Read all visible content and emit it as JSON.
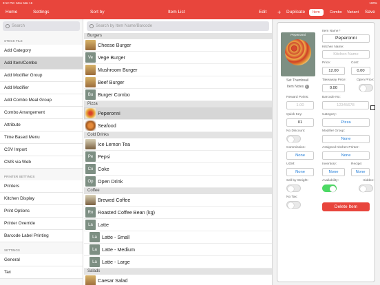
{
  "status": {
    "time": "9:12 PM",
    "date": "Mon Mar 16",
    "battery": "100%"
  },
  "topbar": {
    "home": "Home",
    "settings": "Settings",
    "sort_by": "Sort by",
    "item_list": "Item List",
    "edit": "Edit",
    "plus": "+",
    "duplicate": "Duplicate",
    "segments": [
      "Item",
      "Combo",
      "Variant"
    ],
    "active_segment": "Item",
    "save": "Save"
  },
  "sidebar": {
    "search_placeholder": "Search",
    "stock_file_header": "STOCK FILE",
    "stock_items": [
      "Add Category",
      "Add Item/Combo",
      "Add Modifier Group",
      "Add Modifier",
      "Add Combo Meal Group",
      "Combo Arrangement",
      "Attribute",
      "Time Based Menu",
      "CSV Import",
      "CMS via Web"
    ],
    "selected": "Add Item/Combo",
    "printer_header": "PRINTER SETTINGS",
    "printer_items": [
      "Printers",
      "Kitchen Display",
      "Print Options",
      "Printer Override",
      "Barcode Label Printing"
    ],
    "settings_header": "SETTINGS",
    "settings_items": [
      "General",
      "Tax"
    ]
  },
  "list": {
    "search_placeholder": "Search by Item Name/Barcode",
    "categories": [
      {
        "name": "Burgers",
        "items": [
          {
            "abbr": "",
            "name": "Cheese Burger",
            "thumb": "cb"
          },
          {
            "abbr": "Ve",
            "name": "Vege Burger"
          },
          {
            "abbr": "",
            "name": "Mushroom Burger",
            "thumb": "cb"
          },
          {
            "abbr": "",
            "name": "Beef Burger",
            "thumb": "cb"
          },
          {
            "abbr": "Bu",
            "name": "Burger Combo"
          }
        ]
      },
      {
        "name": "Pizza",
        "items": [
          {
            "abbr": "",
            "name": "Peperonni",
            "thumb": "pz",
            "selected": true
          },
          {
            "abbr": "",
            "name": "Seafood",
            "thumb": "sf"
          }
        ]
      },
      {
        "name": "Cold Drinks",
        "items": [
          {
            "abbr": "",
            "name": "Ice Lemon Tea",
            "thumb": "ic"
          },
          {
            "abbr": "Pe",
            "name": "Pepsi"
          },
          {
            "abbr": "Co",
            "name": "Coke"
          },
          {
            "abbr": "Op",
            "name": "Open Drink"
          }
        ]
      },
      {
        "name": "Coffee",
        "items": [
          {
            "abbr": "",
            "name": "Brewed Coffee",
            "thumb": "ic"
          },
          {
            "abbr": "Ro",
            "name": "Roasted Coffee Bean (kg)"
          },
          {
            "abbr": "La",
            "name": "Latte"
          },
          {
            "abbr": "La",
            "name": "Latte - Small",
            "indent": true
          },
          {
            "abbr": "La",
            "name": "Latte - Medium",
            "indent": true
          },
          {
            "abbr": "La",
            "name": "Latte - Large",
            "indent": true
          }
        ]
      },
      {
        "name": "Salads",
        "items": [
          {
            "abbr": "",
            "name": "Caesar Salad",
            "thumb": "cb"
          }
        ]
      }
    ]
  },
  "detail": {
    "image_title": "Peperonni",
    "set_thumbnail": "Set Thumbnail",
    "item_notes": "Item Notes",
    "item_name_label": "Item Name:*",
    "item_name": "Peperonni",
    "kitchen_name_label": "Kitchen Name:",
    "kitchen_name_placeholder": "Kitchen Name",
    "price_label": "Price:",
    "price": "12.00",
    "cost_label": "Cost:",
    "cost": "0.00",
    "takeaway_label": "Takeaway Price:",
    "takeaway": "0.00",
    "open_price_label": "Open Price:",
    "reward_label": "Reward Points:",
    "reward_placeholder": "1.00",
    "barcode_label": "Barcode No:",
    "barcode_placeholder": "12345678",
    "quick_key_label": "Quick Key:",
    "quick_key": "01",
    "category_label": "Category:",
    "category": "Pizza",
    "no_discount_label": "No Discount:",
    "modifier_group_label": "Modifier Group:",
    "modifier_group": "None",
    "commission_label": "Commission:",
    "commission": "None",
    "assigned_printer_label": "Assigned Kitchen Printer:",
    "assigned_printer": "None",
    "uom_label": "UOM:",
    "uom": "None",
    "inventory_label": "Inventory:",
    "inventory": "None",
    "recipe_label": "Recipe:",
    "recipe": "None",
    "sell_weight_label": "Sell by Weight:",
    "availability_label": "Availability:",
    "hidden_label": "Hidden:",
    "no_tax_label": "No Tax:",
    "delete_label": "Delete Item"
  },
  "colors": {
    "accent": "#e8453c",
    "link_blue": "#1a79d8",
    "toggle_on": "#4cd964"
  }
}
